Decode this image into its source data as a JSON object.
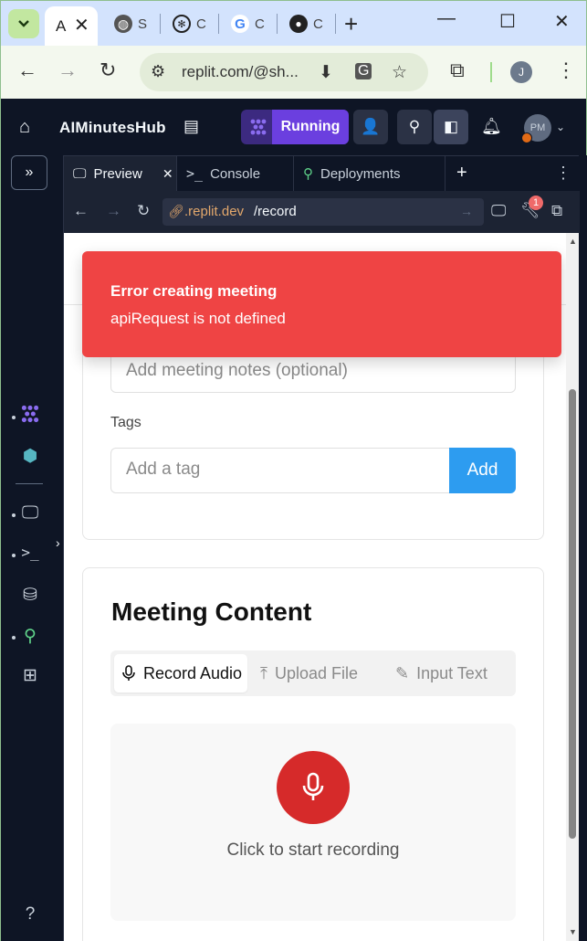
{
  "browser": {
    "tabs": [
      {
        "label": "A",
        "active": true
      },
      {
        "label": "S"
      },
      {
        "label": "C"
      },
      {
        "label": "C"
      },
      {
        "label": "C"
      }
    ],
    "address": "replit.com/@sh..."
  },
  "replit": {
    "project_name": "AIMinutesHub",
    "run_label": "Running",
    "avatar_initials": "PM"
  },
  "pane": {
    "tabs": [
      "Preview",
      "Console",
      "Deployments"
    ],
    "url_domain": ".replit.dev",
    "url_path": "/record",
    "badge_count": "1"
  },
  "page": {
    "notes_placeholder": "Add meeting notes (optional)",
    "tags_label": "Tags",
    "tag_placeholder": "Add a tag",
    "add_button": "Add",
    "content_title": "Meeting Content",
    "modes": [
      "Record Audio",
      "Upload File",
      "Input Text"
    ],
    "record_hint": "Click to start recording"
  },
  "toast": {
    "title": "Error creating meeting",
    "message": "apiRequest is not defined"
  },
  "colors": {
    "toast_bg": "#ef4444",
    "run_purple": "#6b3fdf",
    "mic_red": "#d62a2a",
    "add_blue": "#2d9cf0"
  },
  "icons": [
    "tab-search-icon",
    "close-icon",
    "globe-icon",
    "chatgpt-icon",
    "google-icon",
    "github-icon",
    "plus-icon",
    "minimize-icon",
    "maximize-icon",
    "back-icon",
    "forward-icon",
    "reload-icon",
    "site-settings-icon",
    "install-icon",
    "translate-icon",
    "star-icon",
    "extensions-icon",
    "menu-icon",
    "home-icon",
    "file-icon",
    "run-icon",
    "invite-icon",
    "deploy-icon",
    "new-window-icon",
    "bell-icon",
    "monitor-icon",
    "terminal-icon",
    "database-icon",
    "grid-icon",
    "help-icon",
    "mic-icon",
    "upload-icon",
    "pencil-icon"
  ]
}
